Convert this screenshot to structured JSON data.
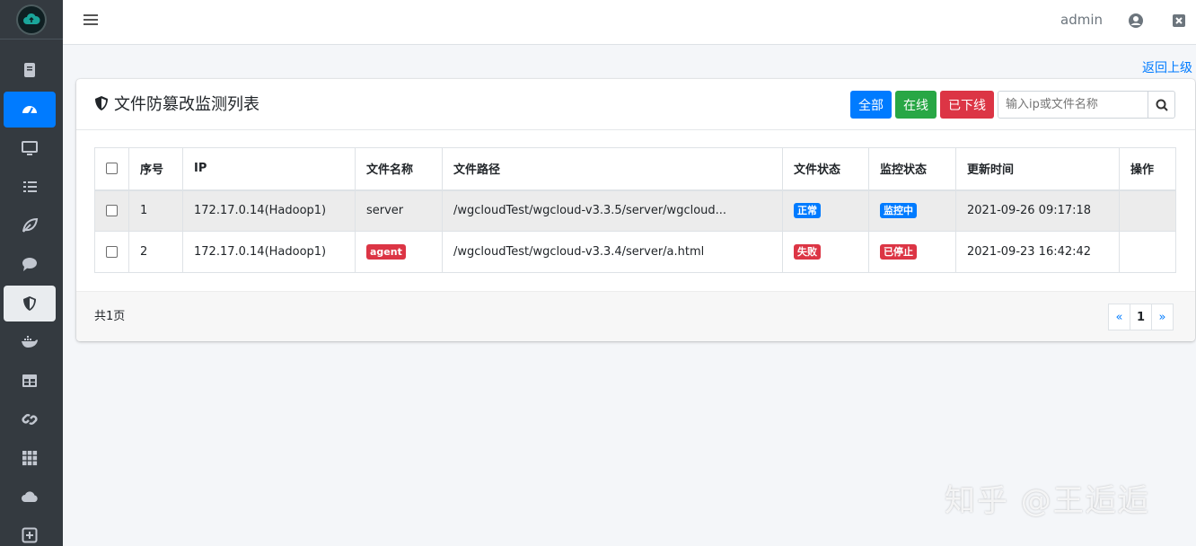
{
  "header": {
    "username": "admin"
  },
  "back_link": "返回上级",
  "card": {
    "title": "文件防篡改监测列表",
    "buttons": {
      "all": "全部",
      "online": "在线",
      "offline": "已下线"
    },
    "search_placeholder": "输入ip或文件名称"
  },
  "table": {
    "columns": [
      "序号",
      "IP",
      "文件名称",
      "文件路径",
      "文件状态",
      "监控状态",
      "更新时间",
      "操作"
    ],
    "rows": [
      {
        "index": "1",
        "ip": "172.17.0.14(Hadoop1)",
        "file_name": "server",
        "file_path": "/wgcloudTest/wgcloud-v3.3.5/server/wgcloud...",
        "file_status": "正常",
        "monitor_status": "监控中",
        "updated": "2021-09-26 09:17:18",
        "action": ""
      },
      {
        "index": "2",
        "ip": "172.17.0.14(Hadoop1)",
        "file_name": "agent",
        "file_path": "/wgcloudTest/wgcloud-v3.3.4/server/a.html",
        "file_status": "失败",
        "monitor_status": "已停止",
        "updated": "2021-09-23 16:42:42",
        "action": ""
      }
    ]
  },
  "footer": {
    "total_pages": "共1页",
    "pager": {
      "prev": "«",
      "current": "1",
      "next": "»"
    }
  },
  "watermark": "知乎 @王逅逅",
  "colors": {
    "primary": "#007bff",
    "success": "#28a745",
    "danger": "#dc3545",
    "sidebar": "#343a40"
  },
  "sidebar_icons": [
    "book-icon",
    "dashboard-icon",
    "monitor-icon",
    "task-list-icon",
    "leaf-icon",
    "chat-icon",
    "shield-icon",
    "docker-icon",
    "table-icon",
    "link-icon",
    "grid-icon",
    "cloud-icon",
    "plus-square-icon"
  ]
}
